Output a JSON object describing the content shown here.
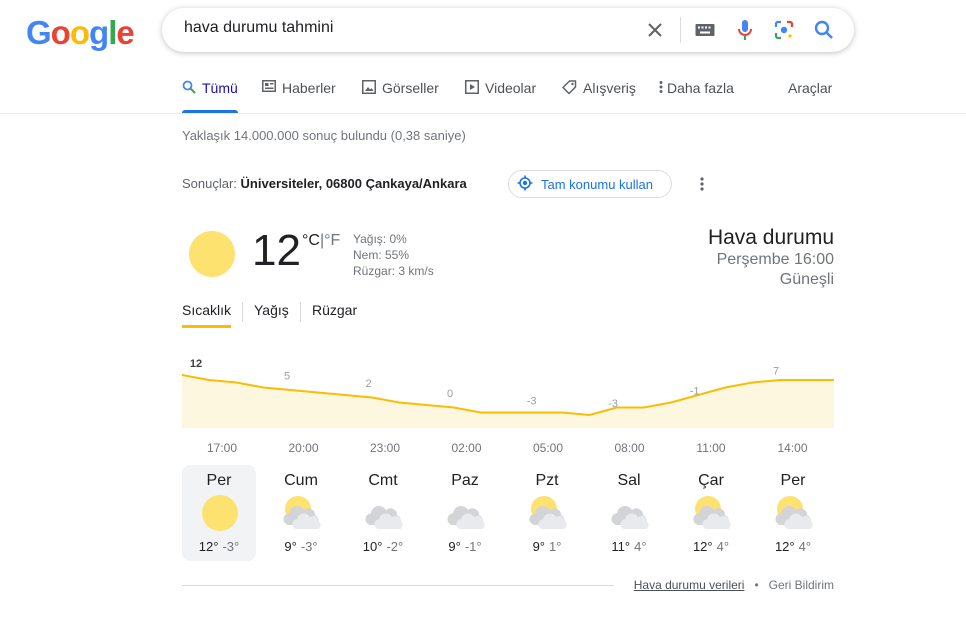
{
  "logo": {
    "text": "Google",
    "letters": [
      "G",
      "o",
      "o",
      "g",
      "l",
      "e"
    ],
    "colors": [
      "#4285F4",
      "#EA4335",
      "#FBBC05",
      "#4285F4",
      "#34A853",
      "#EA4335"
    ]
  },
  "search": {
    "query": "hava durumu tahmini",
    "icons": [
      "clear-icon",
      "keyboard-icon",
      "microphone-icon",
      "lens-icon",
      "search-icon"
    ]
  },
  "tabs": [
    {
      "label": "Tümü",
      "icon": "search-icon",
      "active": true
    },
    {
      "label": "Haberler",
      "icon": "news-icon"
    },
    {
      "label": "Görseller",
      "icon": "image-icon"
    },
    {
      "label": "Videolar",
      "icon": "video-icon"
    },
    {
      "label": "Alışveriş",
      "icon": "tag-icon"
    },
    {
      "label": "Daha fazla",
      "icon": "more-vert-icon"
    }
  ],
  "tools_label": "Araçlar",
  "result_stats": "Yaklaşık 14.000.000 sonuç bulundu (0,38 saniye)",
  "location": {
    "prefix": "Sonuçlar:",
    "place": "Üniversiteler, 06800 Çankaya/Ankara",
    "button": "Tam konumu kullan"
  },
  "weather": {
    "temperature": "12",
    "unit_c": "°C",
    "unit_sep": "|",
    "unit_f": "°F",
    "precip": "Yağış: 0%",
    "humidity": "Nem: 55%",
    "wind": "Rüzgar: 3 km/s",
    "title": "Hava durumu",
    "time": "Perşembe 16:00",
    "condition": "Güneşli",
    "tabs": [
      "Sıcaklık",
      "Yağış",
      "Rüzgar"
    ],
    "active_tab": "Sıcaklık",
    "accent_color": "#fbbc04",
    "fill_color": "#fef7e0"
  },
  "chart_data": {
    "type": "area",
    "x": [
      "17:00",
      "18:00",
      "19:00",
      "20:00",
      "21:00",
      "22:00",
      "23:00",
      "00:00",
      "01:00",
      "02:00",
      "03:00",
      "04:00",
      "05:00",
      "06:00",
      "07:00",
      "08:00",
      "09:00",
      "10:00",
      "11:00",
      "12:00",
      "13:00",
      "14:00",
      "15:00",
      "16:00"
    ],
    "values": [
      12,
      10,
      9,
      7,
      6,
      5,
      4,
      3,
      1,
      0,
      -1,
      -3,
      -3,
      -3,
      -3,
      -4,
      -1,
      -1,
      1,
      4,
      7,
      9,
      10,
      10
    ],
    "labels": [
      {
        "time": "17:00",
        "value": "12"
      },
      {
        "time": "20:00",
        "value": "5"
      },
      {
        "time": "23:00",
        "value": "2"
      },
      {
        "time": "02:00",
        "value": "0"
      },
      {
        "time": "05:00",
        "value": "-3"
      },
      {
        "time": "08:00",
        "value": "-3"
      },
      {
        "time": "11:00",
        "value": "-1"
      },
      {
        "time": "14:00",
        "value": "7"
      }
    ],
    "tick_labels": [
      "17:00",
      "20:00",
      "23:00",
      "02:00",
      "05:00",
      "08:00",
      "11:00",
      "14:00"
    ],
    "ylim": [
      -6,
      14
    ],
    "grid": false
  },
  "forecast": [
    {
      "day": "Per",
      "hi": "12°",
      "lo": "-3°",
      "icon": "sunny-icon",
      "selected": true
    },
    {
      "day": "Cum",
      "hi": "9°",
      "lo": "-3°",
      "icon": "partly-cloudy-icon"
    },
    {
      "day": "Cmt",
      "hi": "10°",
      "lo": "-2°",
      "icon": "cloudy-icon"
    },
    {
      "day": "Paz",
      "hi": "9°",
      "lo": "-1°",
      "icon": "cloudy-icon"
    },
    {
      "day": "Pzt",
      "hi": "9°",
      "lo": "1°",
      "icon": "partly-cloudy-icon"
    },
    {
      "day": "Sal",
      "hi": "11°",
      "lo": "4°",
      "icon": "cloudy-icon"
    },
    {
      "day": "Çar",
      "hi": "12°",
      "lo": "4°",
      "icon": "partly-cloudy-icon"
    },
    {
      "day": "Per",
      "hi": "12°",
      "lo": "4°",
      "icon": "partly-cloudy-icon"
    }
  ],
  "footer": {
    "source": "Hava durumu verileri",
    "separator": "•",
    "feedback": "Geri Bildirim"
  }
}
